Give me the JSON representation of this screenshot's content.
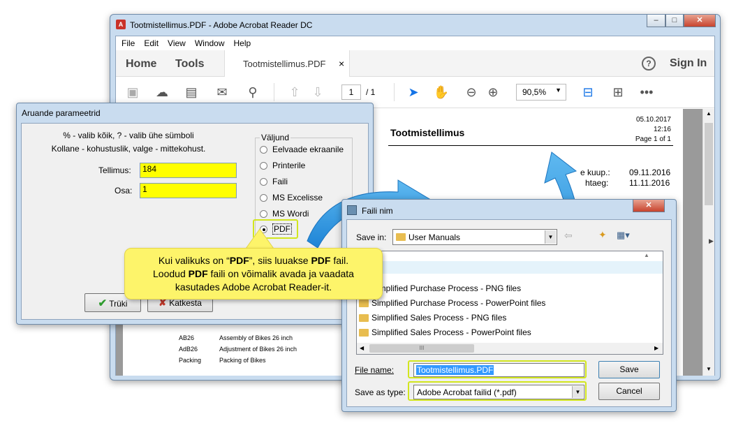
{
  "acrobat": {
    "title": "Tootmistellimus.PDF - Adobe Acrobat Reader DC",
    "menu": [
      "File",
      "Edit",
      "View",
      "Window",
      "Help"
    ],
    "home": "Home",
    "tools": "Tools",
    "doc_tab": "Tootmistellimus.PDF",
    "tab_close": "×",
    "help": "?",
    "sign_in": "Sign In",
    "page_current": "1",
    "page_total": "/ 1",
    "zoom": "90,5%",
    "doc": {
      "title": "Tootmistellimus",
      "date": "05.10.2017",
      "time": "12:16",
      "page": "Page 1 of 1",
      "meta1_label": "e kuup.:",
      "meta1_value": "09.11.2016",
      "meta2_label": "htaeg:",
      "meta2_value": "11.11.2016",
      "rows": [
        {
          "code": "AB26",
          "desc": "Assembly of Bikes 26 inch"
        },
        {
          "code": "AdB26",
          "desc": "Adjustment of Bikes 26 inch"
        },
        {
          "code": "Packing",
          "desc": "Packing of Bikes"
        }
      ]
    }
  },
  "params": {
    "title": "Aruande parameetrid",
    "hint1": "% - valib kõik, ? - valib ühe sümboli",
    "hint2": "Kollane - kohustuslik, valge - mittekohust.",
    "order_label": "Tellimus:",
    "order_value": "184",
    "part_label": "Osa:",
    "part_value": "1",
    "output_group": "Väljund",
    "options": [
      "Eelvaade ekraanile",
      "Printerile",
      "Faili",
      "MS Excelisse",
      "MS Wordi",
      "PDF"
    ],
    "print_btn": "Trüki",
    "cancel_btn": "Katkesta"
  },
  "callout": {
    "line1a": "Kui valikuks on “",
    "line1b": "PDF",
    "line1c": "”, siis luuakse ",
    "line1d": "PDF",
    "line1e": " fail.",
    "line2a": "Loodud ",
    "line2b": "PDF",
    "line2c": " faili on võimalik avada ja vaadata",
    "line3": "kasutades Adobe Acrobat Reader-it."
  },
  "save": {
    "title": "Faili nim",
    "save_in_label": "Save in:",
    "save_in_value": "User Manuals",
    "items": [
      "licy",
      "Simplified Purchase Process - PNG files",
      "Simplified Purchase Process - PowerPoint files",
      "Simplified Sales Process - PNG files",
      "Simplified Sales Process - PowerPoint files"
    ],
    "file_name_label": "File name:",
    "file_name_value": "Tootmistellimus.PDF",
    "type_label": "Save as type:",
    "type_value": "Adobe Acrobat failid (*.pdf)",
    "save_btn": "Save",
    "cancel_btn": "Cancel",
    "scroll_mid": "III"
  },
  "colors": {
    "field": "#ffff00",
    "highlight": "#d2e61e",
    "callout": "#fdf46a",
    "arrow": "#2f9ae0",
    "acrobat_blue": "#1473e6"
  }
}
